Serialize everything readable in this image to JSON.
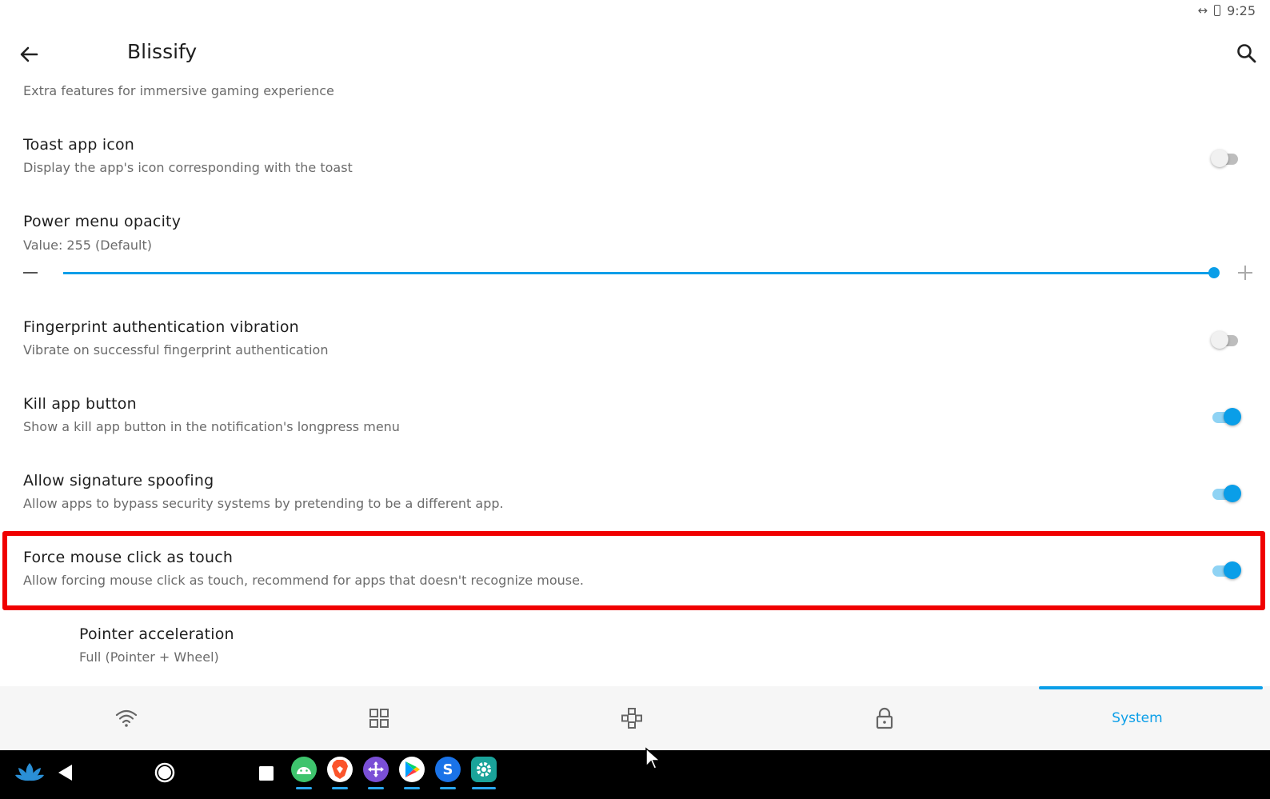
{
  "status_bar": {
    "time": "9:25",
    "icons": [
      "link-icon",
      "battery-icon"
    ]
  },
  "app_bar": {
    "title": "Blissify",
    "back_icon": "arrow-left-icon",
    "search_icon": "search-icon"
  },
  "section_description": "Extra features for immersive gaming experience",
  "settings": [
    {
      "title": "Toast app icon",
      "summary": "Display the app's icon corresponding with the toast",
      "enabled": false
    },
    {
      "title": "Power menu opacity",
      "value_text": "Value: 255  (Default)",
      "slider": {
        "value": 255,
        "min": 0,
        "max": 255
      }
    },
    {
      "title": "Fingerprint authentication vibration",
      "summary": "Vibrate on successful fingerprint authentication",
      "enabled": false
    },
    {
      "title": "Kill app button",
      "summary": "Show a kill app button in the notification's longpress menu",
      "enabled": true
    },
    {
      "title": "Allow signature spoofing",
      "summary": "Allow apps to bypass security systems by pretending to be a different app.",
      "enabled": true
    },
    {
      "title": "Force mouse click as touch",
      "summary": "Allow forcing mouse click as touch, recommend for apps that doesn't recognize mouse.",
      "enabled": true,
      "highlighted": true
    },
    {
      "title": "Pointer acceleration",
      "summary": "Full (Pointer + Wheel)"
    }
  ],
  "bottom_nav": {
    "tabs": [
      {
        "icon": "wifi-icon"
      },
      {
        "icon": "grid-icon"
      },
      {
        "icon": "gamepad-icon"
      },
      {
        "icon": "lock-icon"
      },
      {
        "label": "System",
        "selected": true
      }
    ]
  },
  "taskbar": {
    "items": [
      "lotus-icon",
      "back-triangle-icon",
      "home-circle-icon",
      "recents-square-icon"
    ],
    "apps": [
      {
        "icon": "android-app-icon",
        "color": "#3ec46d",
        "letter": ""
      },
      {
        "icon": "brave-browser-icon",
        "color": "#fb542b",
        "letter": ""
      },
      {
        "icon": "move-app-icon",
        "color": "#7a4fd6",
        "letter": ""
      },
      {
        "icon": "play-store-icon",
        "color": "#ffffff",
        "letter": ""
      },
      {
        "icon": "s-app-icon",
        "color": "#1a73e8",
        "letter": "S"
      },
      {
        "icon": "settings-app-icon",
        "color": "#1aa39a",
        "letter": ""
      }
    ]
  },
  "colors": {
    "accent": "#0a9ee8",
    "highlight": "#f00000",
    "taskbar": "#000000"
  }
}
